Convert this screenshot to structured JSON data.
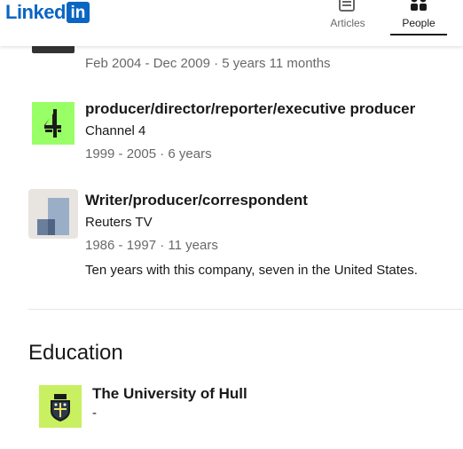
{
  "header": {
    "logo_text": "Linked",
    "logo_in": "in",
    "nav": {
      "articles_label": "Articles",
      "people_label": "People"
    }
  },
  "experience": [
    {
      "dates": "Feb 2004 - Dec 2009 · 5 years 11 months"
    },
    {
      "title": "producer/director/reporter/executive producer",
      "company": "Channel 4",
      "dates": "1999 - 2005 · 6 years",
      "logo_icon": "channel-4-logo"
    },
    {
      "title": "Writer/producer/correspondent",
      "company": "Reuters TV",
      "dates": "1986 - 1997 · 11 years",
      "description": "Ten years with this company, seven in the United States.",
      "logo_icon": "reuters-tv-logo"
    }
  ],
  "education": {
    "section_title": "Education",
    "items": [
      {
        "school": "The University of Hull",
        "detail": "-",
        "logo_icon": "university-of-hull-crest"
      }
    ]
  },
  "colors": {
    "brand": "#0a66c2",
    "channel4_bg": "#99ff66",
    "hull_bg": "#c8f060"
  }
}
